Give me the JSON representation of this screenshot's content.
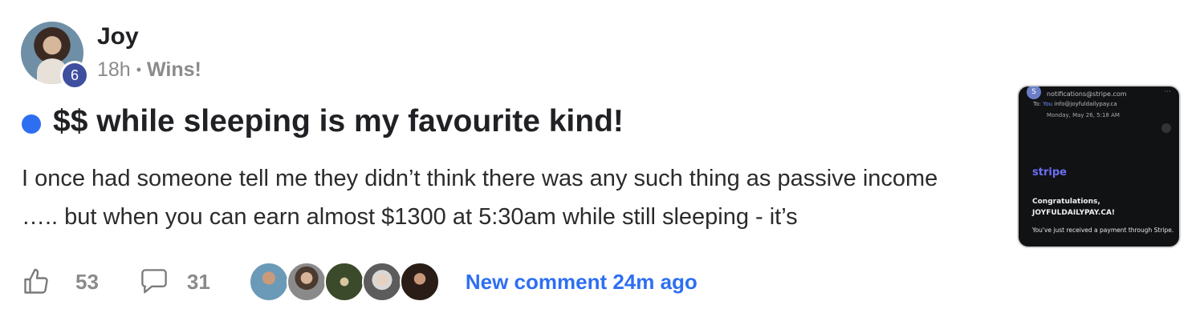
{
  "post": {
    "author": "Joy",
    "level": "6",
    "time_ago": "18h",
    "separator": "•",
    "category": "Wins!",
    "title": "$$ while sleeping is my favourite kind!",
    "body": "I once had someone tell me they didn’t think there was any such thing as passive income ….. but when you can earn almost $1300 at 5:30am while still sleeping - it’s",
    "likes": "53",
    "comments": "31",
    "new_comment": "New comment 24m ago",
    "unread_color": "#2e6ff2",
    "accent_color": "#2e6ff2"
  },
  "icons": {
    "like": "thumbs-up-icon",
    "comment": "speech-bubble-icon"
  },
  "thumbnail": {
    "sender_initial": "S",
    "from": "notifications@stripe.com",
    "to_label": "To:",
    "to_you": "You",
    "to_address": "info@joyfuldailypay.ca",
    "date": "Monday, May 26, 5:18 AM",
    "menu": "···",
    "brand": "stripe",
    "congrats": "Congratulations, JOYFULDAILYPAY.CA!",
    "received": "You've just received a payment through Stripe."
  }
}
